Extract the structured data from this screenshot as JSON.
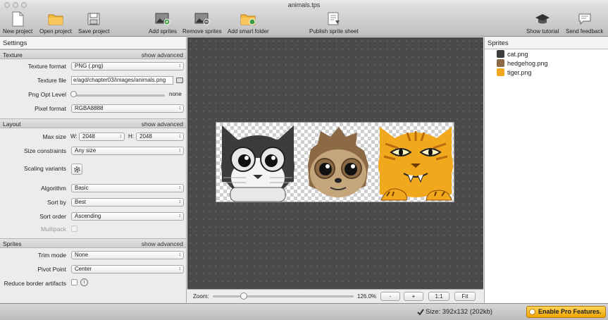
{
  "window": {
    "title": "animals.tps"
  },
  "toolbar": {
    "new_project": "New project",
    "open_project": "Open project",
    "save_project": "Save project",
    "add_sprites": "Add sprites",
    "remove_sprites": "Remove sprites",
    "add_smart_folder": "Add smart folder",
    "publish_sprite_sheet": "Publish sprite sheet",
    "show_tutorial": "Show tutorial",
    "send_feedback": "Send feedback"
  },
  "settings": {
    "title": "Settings",
    "show_advanced": "show advanced",
    "texture": {
      "header": "Texture",
      "format_label": "Texture format",
      "format_value": "PNG (.png)",
      "file_label": "Texture file",
      "file_value": "e/agd/chapter03/images/animals.png",
      "png_opt_label": "Png Opt Level",
      "png_opt_value": "none",
      "png_opt_level": 0,
      "pixel_format_label": "Pixel format",
      "pixel_format_value": "RGBA8888"
    },
    "layout": {
      "header": "Layout",
      "max_size_label": "Max size",
      "w_label": "W:",
      "w_value": "2048",
      "h_label": "H:",
      "h_value": "2048",
      "size_constraints_label": "Size constraints",
      "size_constraints_value": "Any size",
      "scaling_variants_label": "Scaling variants",
      "algorithm_label": "Algorithm",
      "algorithm_value": "Basic",
      "sort_by_label": "Sort by",
      "sort_by_value": "Best",
      "sort_order_label": "Sort order",
      "sort_order_value": "Ascending",
      "multipack_label": "Multipack"
    },
    "sprites": {
      "header": "Sprites",
      "trim_mode_label": "Trim mode",
      "trim_mode_value": "None",
      "pivot_label": "Pivot Point",
      "pivot_value": "Center",
      "reduce_border_label": "Reduce border artifacts"
    }
  },
  "canvas": {
    "zoom_label": "Zoom:",
    "zoom_value": "126.0%",
    "zoom_fraction": 0.22,
    "zoom_out": "-",
    "zoom_in": "+",
    "one_to_one": "1:1",
    "fit": "Fit"
  },
  "sprites_panel": {
    "title": "Sprites",
    "items": [
      {
        "name": "cat.png",
        "icon": "cat-icon"
      },
      {
        "name": "hedgehog.png",
        "icon": "hedgehog-icon"
      },
      {
        "name": "tiger.png",
        "icon": "tiger-icon"
      }
    ]
  },
  "status": {
    "size": "Size: 392x132 (202kb)",
    "pro_button": "Enable Pro Features."
  },
  "colors": {
    "canvas_bg": "#4a4a4a",
    "pro_accent": "#f0a500",
    "tiger": "#f2a81d",
    "hedgehog": "#8b6a45",
    "cat": "#3c3c3c"
  }
}
